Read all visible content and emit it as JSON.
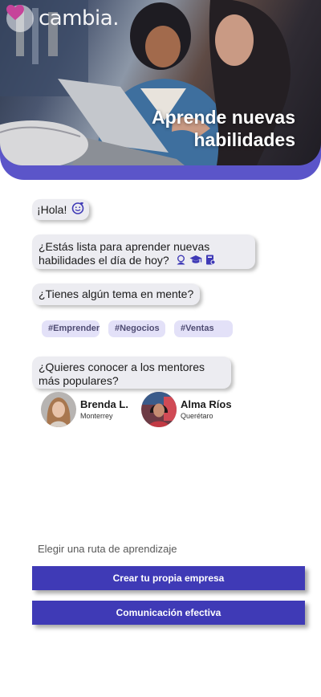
{
  "brand": {
    "name": "cambia."
  },
  "hero": {
    "title": "Aprende nuevas habilidades"
  },
  "chat": {
    "greeting": "¡Hola!",
    "question_learn": "¿Estás lista para aprender nuevas habilidades el día de hoy?",
    "question_topic": "¿Tienes algún tema en mente?",
    "question_mentors": "¿Quieres conocer a los mentores más populares?"
  },
  "tags": [
    "#Emprender",
    "#Negocios",
    "#Ventas"
  ],
  "mentors": [
    {
      "name": "Brenda L.",
      "city": "Monterrey"
    },
    {
      "name": "Alma Ríos",
      "city": "Querétaro"
    }
  ],
  "routes": {
    "label": "Elegir una ruta de aprendizaje",
    "options": [
      "Crear tu propia empresa",
      "Comunicación efectiva"
    ]
  },
  "colors": {
    "primary": "#3f3ab6",
    "hero_band": "#5b55c9",
    "bubble": "#ececf1",
    "tag_bg": "#e3e1f8"
  },
  "icons": [
    "heart-logo-icon",
    "smiley-heart-icon",
    "person-icon",
    "graduation-cap-icon",
    "book-badge-icon"
  ]
}
